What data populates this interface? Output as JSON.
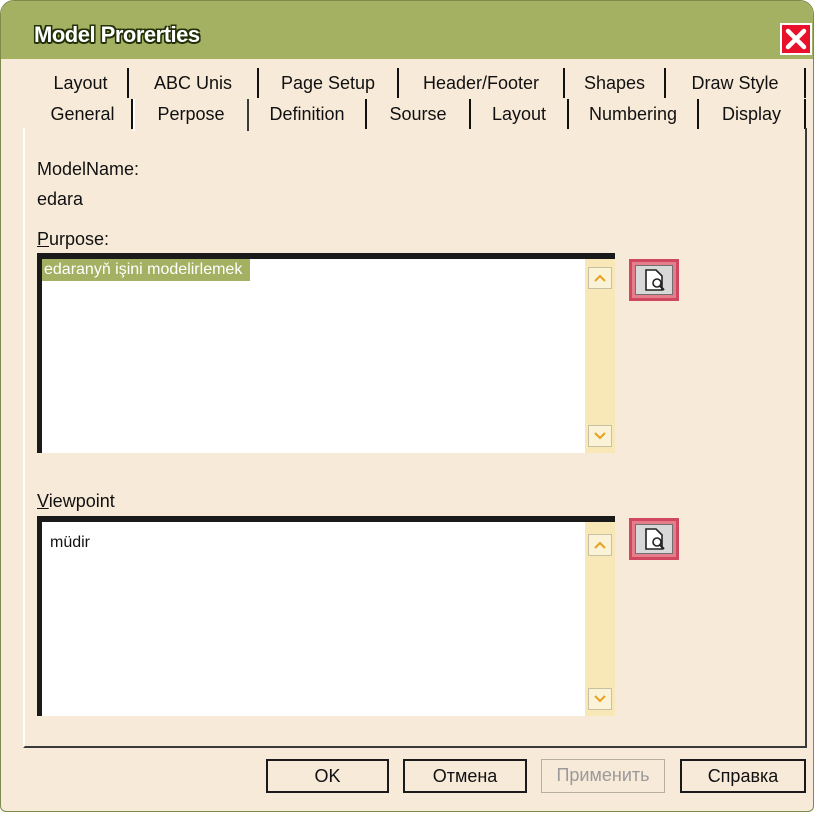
{
  "window": {
    "title": "Model  Prorerties"
  },
  "tabs_row1": [
    "Layout",
    "ABC Unis",
    "Page Setup",
    "Header/Footer",
    "Shapes",
    "Draw Style"
  ],
  "tabs_row2": [
    "General",
    "Perpose",
    "Definition",
    "Sourse",
    "Layout",
    "Numbering",
    "Display"
  ],
  "active_tab": "Perpose",
  "panel": {
    "model_name_label": "ModelName:",
    "model_name_value": "edara",
    "purpose_label_accesskey": "P",
    "purpose_label_rest": "urpose:",
    "purpose_text": "edaranyň işini modelirlemek",
    "viewpoint_label_accesskey": "V",
    "viewpoint_label_rest": "iewpoint",
    "viewpoint_text": "müdir"
  },
  "buttons": {
    "ok": "OK",
    "cancel": "Отмена",
    "apply": "Применить",
    "help": "Справка"
  },
  "icons": {
    "close": "close-icon",
    "browse": "document-search-icon",
    "scroll_up": "chevron-up-icon",
    "scroll_down": "chevron-down-icon"
  },
  "colors": {
    "titlebar": "#a4b062",
    "window_bg": "#f7ead9",
    "close": "#e8102b",
    "selection": "#a4b062"
  }
}
